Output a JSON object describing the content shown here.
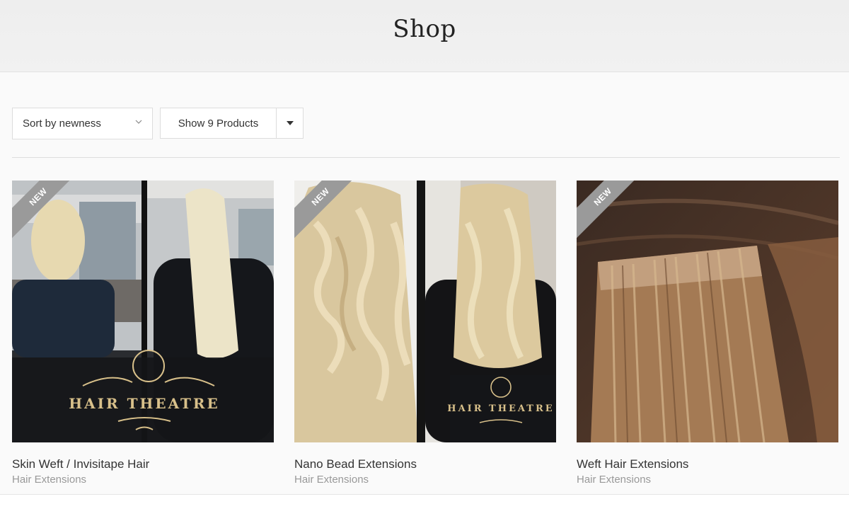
{
  "header": {
    "title": "Shop"
  },
  "toolbar": {
    "sort_label": "Sort by newness",
    "show_label": "Show 9 Products"
  },
  "products": [
    {
      "name": "Skin Weft / Invisitape Hair",
      "category": "Hair Extensions",
      "badge": "NEW",
      "logo_text": "HAIR THEATRE"
    },
    {
      "name": "Nano Bead Extensions",
      "category": "Hair Extensions",
      "badge": "NEW",
      "logo_text": "HAIR THEATRE"
    },
    {
      "name": "Weft Hair Extensions",
      "category": "Hair Extensions",
      "badge": "NEW"
    }
  ],
  "colors": {
    "badge": "#9a9a9a",
    "header_bg": "#eeeeee",
    "category_text": "#999999",
    "logo_gold": "#d8c08a"
  }
}
